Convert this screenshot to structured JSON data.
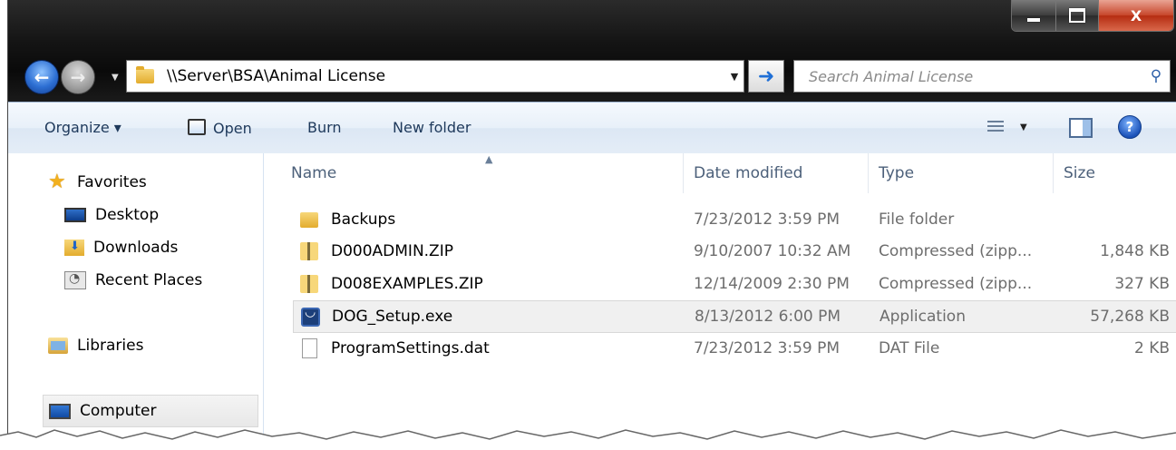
{
  "window": {
    "controls": {
      "minimize": "",
      "maximize": "",
      "close": "X"
    }
  },
  "address": {
    "path": "\\\\Server\\BSA\\Animal License",
    "go_icon": "go-arrow-icon"
  },
  "search": {
    "placeholder": "Search Animal License",
    "icon": "search-icon"
  },
  "toolbar": {
    "organize_label": "Organize ▾",
    "open_label": "Open",
    "burn_label": "Burn",
    "new_folder_label": "New folder",
    "help_label": "?"
  },
  "nav": {
    "favorites": "Favorites",
    "items": [
      {
        "label": "Desktop",
        "icon": "desktop-icon"
      },
      {
        "label": "Downloads",
        "icon": "downloads-icon"
      },
      {
        "label": "Recent Places",
        "icon": "recent-places-icon"
      }
    ],
    "libraries": "Libraries",
    "computer": "Computer"
  },
  "columns": {
    "name": "Name",
    "date": "Date modified",
    "type": "Type",
    "size": "Size"
  },
  "files": [
    {
      "name": "Backups",
      "date": "7/23/2012 3:59 PM",
      "type": "File folder",
      "size": "",
      "icon": "folder-icon"
    },
    {
      "name": "D000ADMIN.ZIP",
      "date": "9/10/2007 10:32 AM",
      "type": "Compressed (zipp...",
      "size": "1,848 KB",
      "icon": "zip-icon"
    },
    {
      "name": "D008EXAMPLES.ZIP",
      "date": "12/14/2009 2:30 PM",
      "type": "Compressed (zipp...",
      "size": "327 KB",
      "icon": "zip-icon"
    },
    {
      "name": "DOG_Setup.exe",
      "date": "8/13/2012 6:00 PM",
      "type": "Application",
      "size": "57,268 KB",
      "icon": "exe-icon"
    },
    {
      "name": "ProgramSettings.dat",
      "date": "7/23/2012 3:59 PM",
      "type": "DAT File",
      "size": "2 KB",
      "icon": "file-icon"
    }
  ],
  "selected_file": "DOG_Setup.exe"
}
